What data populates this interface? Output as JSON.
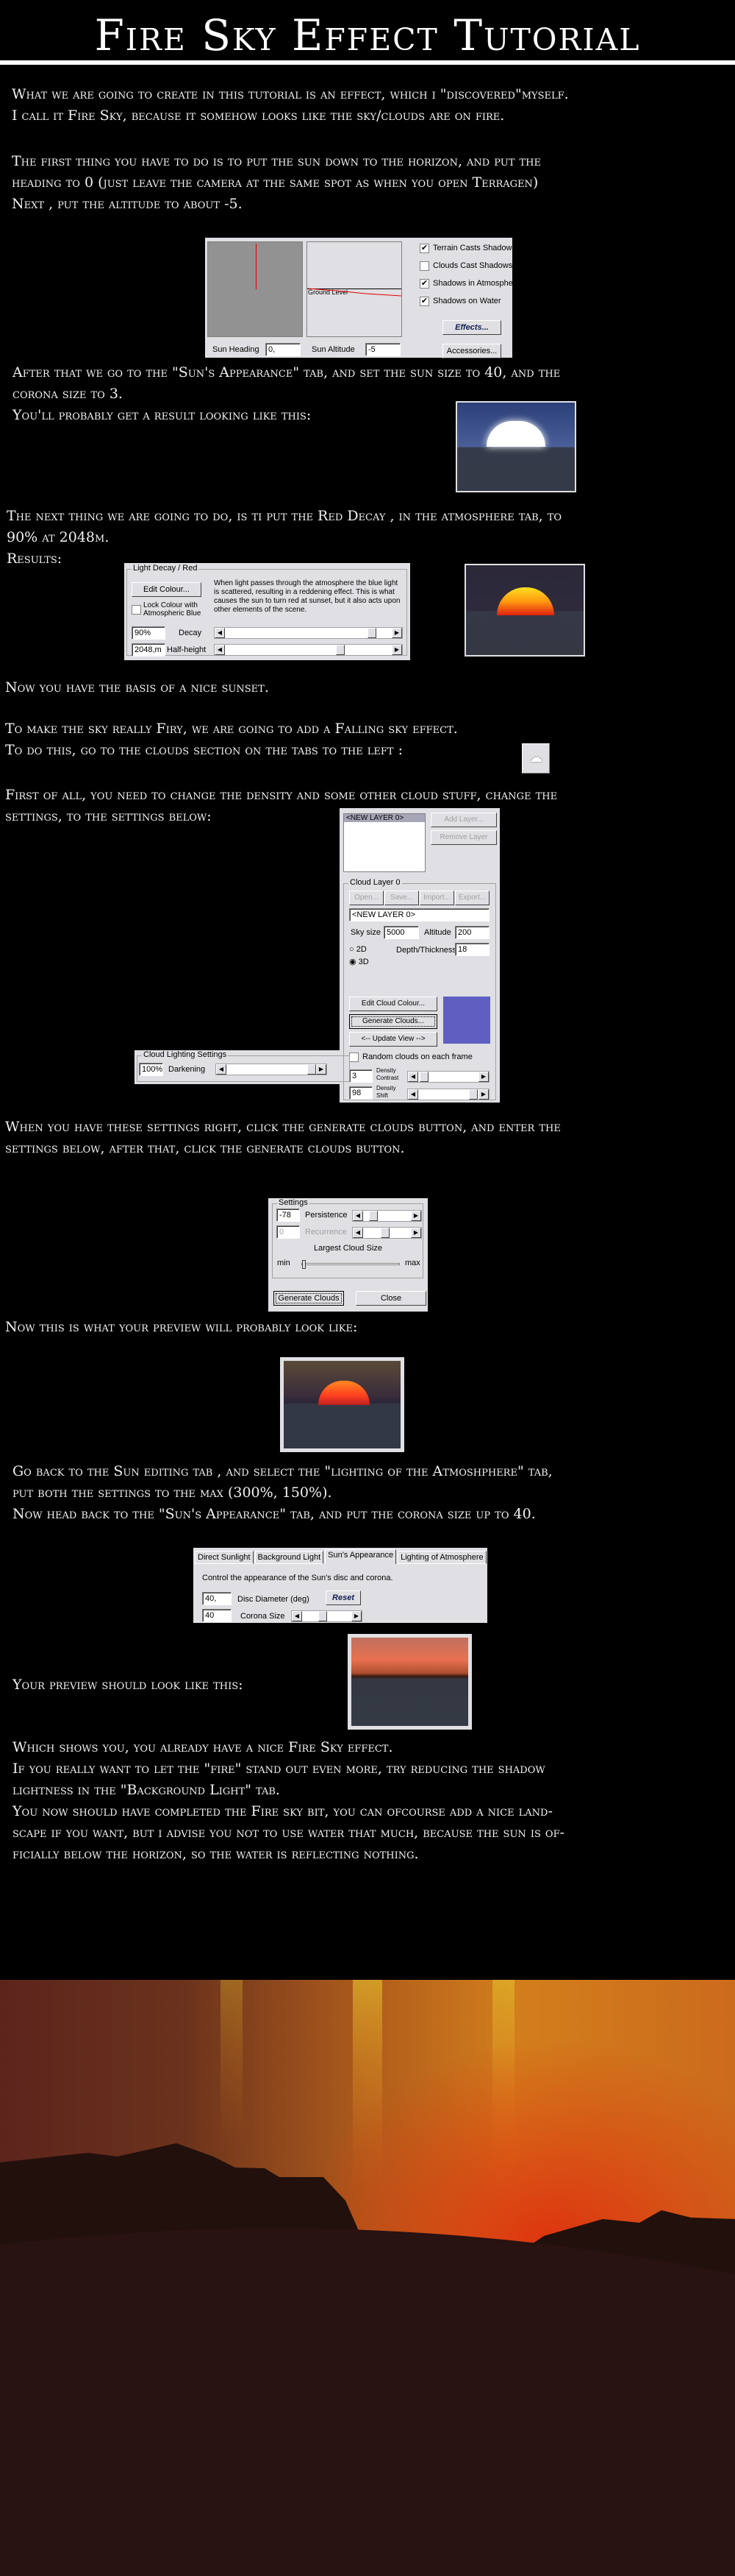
{
  "title": "Fire Sky Effect Tutorial",
  "paragraphs": {
    "p1": [
      "What we are going to create in this tutorial is an effect, which i \"discovered\"myself.",
      "I call it Fire Sky, because it somehow looks like the sky/clouds are on fire."
    ],
    "p2": [
      "The first thing you have to do is to put the sun down to the horizon, and put the",
      "heading to 0 (just leave the camera at the same spot as when you open Terragen)",
      "Next , put the altitude to about -5."
    ],
    "p3": [
      "After that we go to the \"Sun's Appearance\" tab, and set the sun size to 40, and the",
      "corona size to 3.",
      "You'll probably get a result looking like this:"
    ],
    "p4": [
      "The next thing we are going to do, is ti put the Red Decay , in the atmosphere tab, to",
      "90% at 2048m.",
      "Results:"
    ],
    "p5": "Now you have the basis of a nice sunset.",
    "p6": [
      "To make the sky really Firy, we are going to add a Falling sky effect.",
      "To do this, go to the clouds section on the tabs to the left :"
    ],
    "p7": [
      "First of all, you need to change the density and some other cloud stuff, change the",
      "settings, to the settings below:"
    ],
    "p8": [
      "When you have these settings right, click the generate clouds button, and enter the",
      "settings below, after that, click the generate clouds button."
    ],
    "p9": "Now this is what your preview will probably look like:",
    "p10": [
      "Go back to the Sun editing tab , and select the \"lighting of the Atmoshphere\" tab,",
      "put both the settings to the max (300%, 150%).",
      "Now head back to the \"Sun's Appearance\" tab, and put the corona size up to 40."
    ],
    "p11": "Your preview should look like this:",
    "p12": [
      "Which shows you, you already have a nice Fire Sky effect.",
      "If you really want to let the \"fire\" stand out even more, try reducing the shadow",
      "lightness in the \"Background Light\" tab.",
      "You now should have completed the Fire sky bit, you can ofcourse add a nice land-",
      "scape if you want, but i advise you not to use water that much, because the sun is of-",
      "ficially below the horizon, so the water is reflecting nothing."
    ]
  },
  "sun_panel": {
    "ground_level": "Ground Level",
    "checkboxes": [
      {
        "label": "Terrain Casts Shadows",
        "checked": true
      },
      {
        "label": "Clouds Cast Shadows",
        "checked": false
      },
      {
        "label": "Shadows in Atmosphere",
        "checked": true
      },
      {
        "label": "Shadows on Water",
        "checked": true
      }
    ],
    "effects_button": "Effects...",
    "accessories_button": "Accessories...",
    "heading_label": "Sun Heading",
    "heading_value": "0,",
    "altitude_label": "Sun Altitude",
    "altitude_value": "-5"
  },
  "decay_panel": {
    "group": "Light Decay / Red",
    "edit_colour": "Edit Colour...",
    "lock_label": "Lock Colour with Atmospheric Blue",
    "lock_checked": false,
    "description": "When light passes through the atmosphere the blue light is scattered, resulting in a reddening effect. This is what causes the sun to turn red at sunset, but it also acts upon other elements of the scene.",
    "decay_value": "90%",
    "decay_label": "Decay",
    "decay_level": 0.9,
    "halfheight_value": "2048,m",
    "halfheight_label": "Half-height",
    "halfheight_level": 0.7
  },
  "cloud_panel": {
    "layers": [
      "<NEW LAYER 0>"
    ],
    "add_layer": "Add Layer...",
    "remove_layer": "Remove Layer",
    "group": "Cloud Layer 0",
    "open": "Open...",
    "save": "Save...",
    "import": "Import...",
    "export": "Export...",
    "name_value": "<NEW LAYER 0>",
    "sky_size_label": "Sky size",
    "sky_size_value": "5000",
    "altitude_label": "Altitude",
    "altitude_value": "200",
    "radio_2d": "2D",
    "radio_3d": "3D",
    "selected": "3D",
    "depth_label": "Depth/Thickness",
    "depth_value": "18",
    "edit_cloud_colour": "Edit Cloud Colour...",
    "generate": "Generate Clouds...",
    "update_view": "<-- Update View -->",
    "cloud_colour": "#5f5fc2",
    "random_label": "Random clouds on each frame",
    "random_checked": false,
    "contrast_value": "3",
    "contrast_label": "Density Contrast",
    "contrast_level": 0.03,
    "shift_value": "98",
    "shift_label": "Density Shift",
    "shift_level": 0.98
  },
  "lighting_panel": {
    "group": "Cloud Lighting Settings",
    "value": "100%",
    "label": "Darkening",
    "level": 1.0
  },
  "generate_dialog": {
    "group": "Settings",
    "persistence_value": "-78",
    "persistence_label": "Persistence",
    "persistence_level": 0.15,
    "recurrence_value": "0",
    "recurrence_label": "Recurrence",
    "recurrence_level": 0.45,
    "size_label": "Largest Cloud Size",
    "min": "min",
    "max": "max",
    "size_level": 0.0,
    "generate": "Generate Clouds",
    "close": "Close"
  },
  "appearance_panel": {
    "tabs": [
      "Direct Sunlight",
      "Background Light",
      "Sun's Appearance",
      "Lighting of Atmosphere"
    ],
    "active_tab": "Sun's Appearance",
    "description": "Control the appearance of the Sun's disc and corona.",
    "disc_value": "40,",
    "disc_label": "Disc Diameter (deg)",
    "reset": "Reset",
    "corona_value": "40",
    "corona_label": "Corona Size",
    "corona_level": 0.4
  }
}
